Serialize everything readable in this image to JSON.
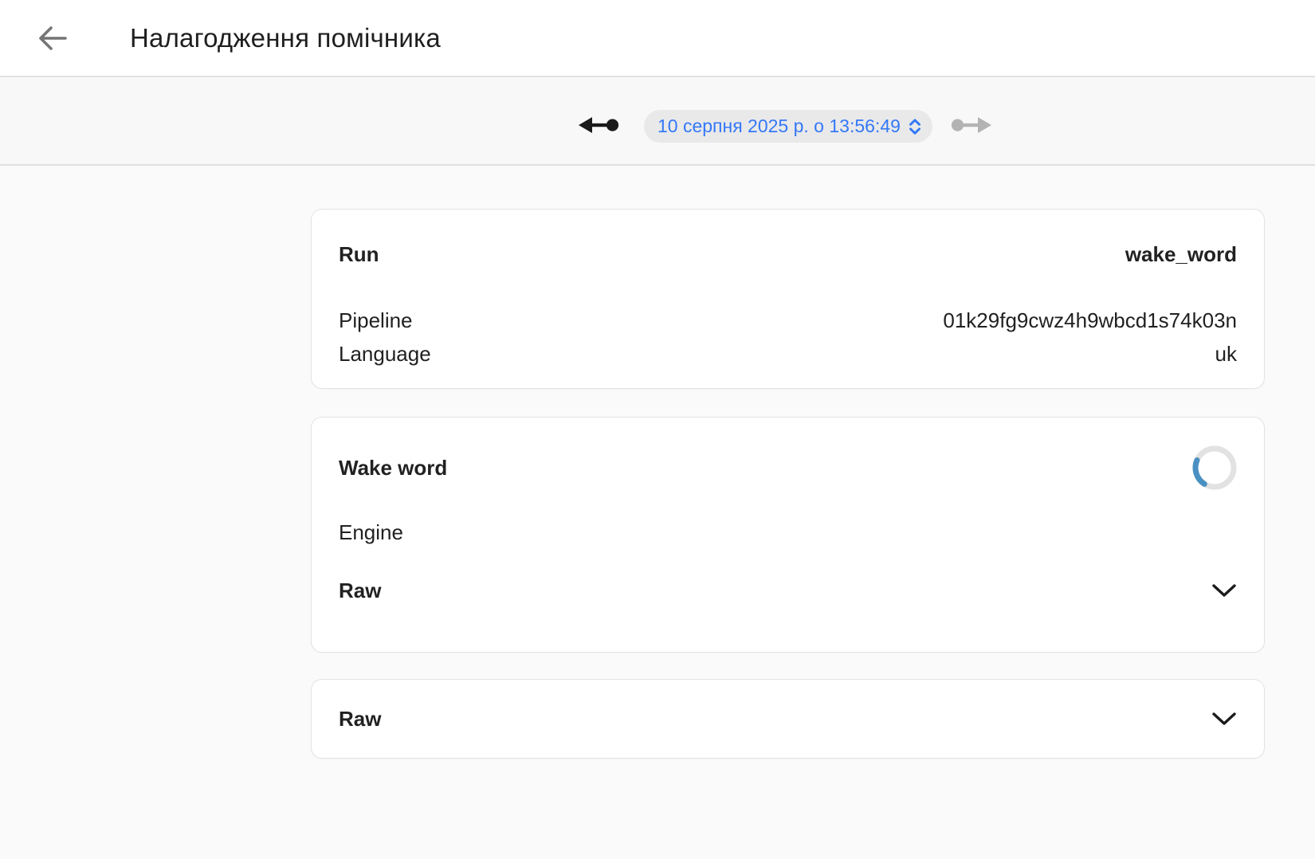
{
  "header": {
    "title": "Налагодження помічника"
  },
  "toolbar": {
    "run_datetime": "10 серпня 2025 р. о 13:56:49"
  },
  "run_card": {
    "run_label": "Run",
    "run_value": "wake_word",
    "pipeline_label": "Pipeline",
    "pipeline_value": "01k29fg9cwz4h9wbcd1s74k03n",
    "language_label": "Language",
    "language_value": "uk"
  },
  "wake_word_card": {
    "title": "Wake word",
    "engine_label": "Engine",
    "raw_label": "Raw"
  },
  "raw_card": {
    "raw_label": "Raw"
  },
  "icons": {
    "back": "arrow-left-icon",
    "previous_run": "ray-end-arrow-left-icon",
    "next_run": "ray-start-arrow-right-icon",
    "datetime_stepper": "up-down-chevrons-icon",
    "expand": "chevron-down-icon",
    "loading": "spinner-icon"
  },
  "colors": {
    "accent_blue": "#3478f6",
    "spinner_arc": "#4a90c2",
    "spinner_track": "#e2e2e2",
    "pill_background": "#e9e9ea",
    "header_background": "#ffffff",
    "page_background": "#fafafa",
    "toolbar_background": "#f8f8f8",
    "text": "#212121",
    "disabled_arrow": "#b3b3b3",
    "back_arrow": "#757575"
  }
}
